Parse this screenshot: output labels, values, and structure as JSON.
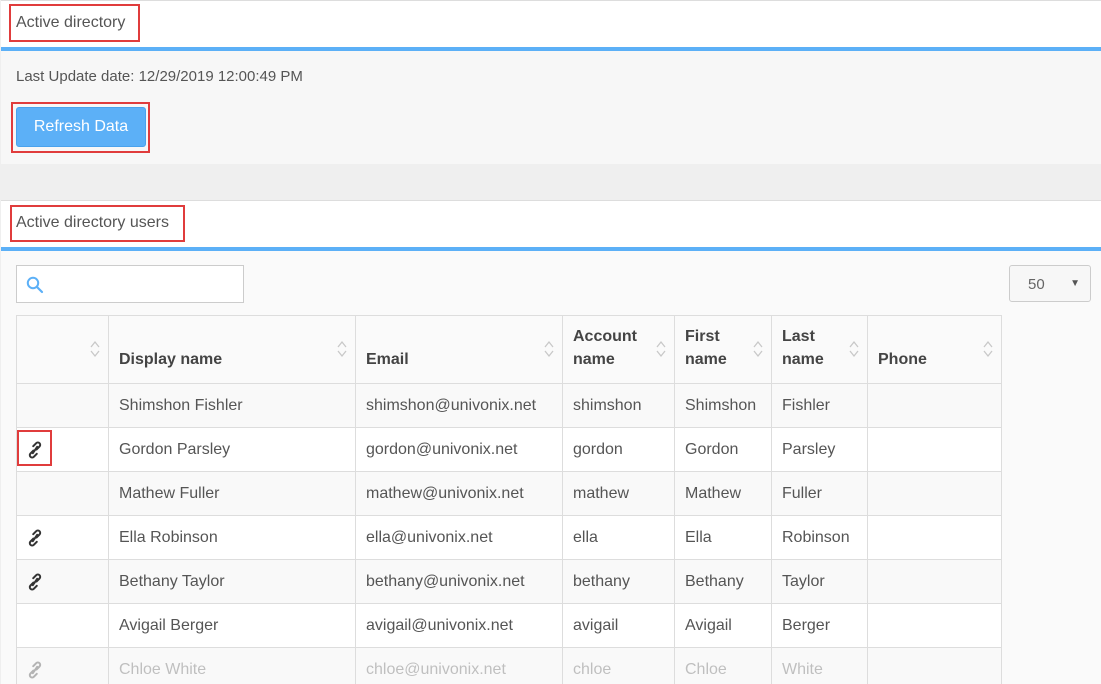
{
  "ad_panel": {
    "title": "Active directory",
    "last_update_label": "Last Update date:",
    "last_update_value": "12/29/2019 12:00:49 PM",
    "refresh_button": "Refresh Data"
  },
  "users_panel": {
    "title": "Active directory users",
    "search": {
      "value": "",
      "placeholder": ""
    },
    "page_size": "50",
    "columns": [
      "",
      "Display name",
      "Email",
      "Account name",
      "First name",
      "Last name",
      "Phone"
    ],
    "columns_wrapped": {
      "account_1": "Account",
      "account_2": "name",
      "first_1": "First",
      "first_2": "name",
      "last_1": "Last",
      "last_2": "name"
    },
    "rows": [
      {
        "linked": false,
        "display": "Shimshon Fishler",
        "email": "shimshon@univonix.net",
        "account": "shimshon",
        "first": "Shimshon",
        "last": "Fishler",
        "phone": ""
      },
      {
        "linked": true,
        "display": "Gordon Parsley",
        "email": "gordon@univonix.net",
        "account": "gordon",
        "first": "Gordon",
        "last": "Parsley",
        "phone": ""
      },
      {
        "linked": false,
        "display": "Mathew Fuller",
        "email": "mathew@univonix.net",
        "account": "mathew",
        "first": "Mathew",
        "last": "Fuller",
        "phone": ""
      },
      {
        "linked": true,
        "display": "Ella Robinson",
        "email": "ella@univonix.net",
        "account": "ella",
        "first": "Ella",
        "last": "Robinson",
        "phone": ""
      },
      {
        "linked": true,
        "display": "Bethany Taylor",
        "email": "bethany@univonix.net",
        "account": "bethany",
        "first": "Bethany",
        "last": "Taylor",
        "phone": ""
      },
      {
        "linked": false,
        "display": "Avigail Berger",
        "email": "avigail@univonix.net",
        "account": "avigail",
        "first": "Avigail",
        "last": "Berger",
        "phone": ""
      },
      {
        "linked": true,
        "display": "Chloe White",
        "email": "chloe@univonix.net",
        "account": "chloe",
        "first": "Chloe",
        "last": "White",
        "phone": ""
      }
    ]
  },
  "colors": {
    "accent": "#5cb0f7",
    "highlight": "#e03c3c"
  },
  "icons": {
    "search": "search-icon",
    "link": "link-icon",
    "sort": "sort-icon"
  }
}
